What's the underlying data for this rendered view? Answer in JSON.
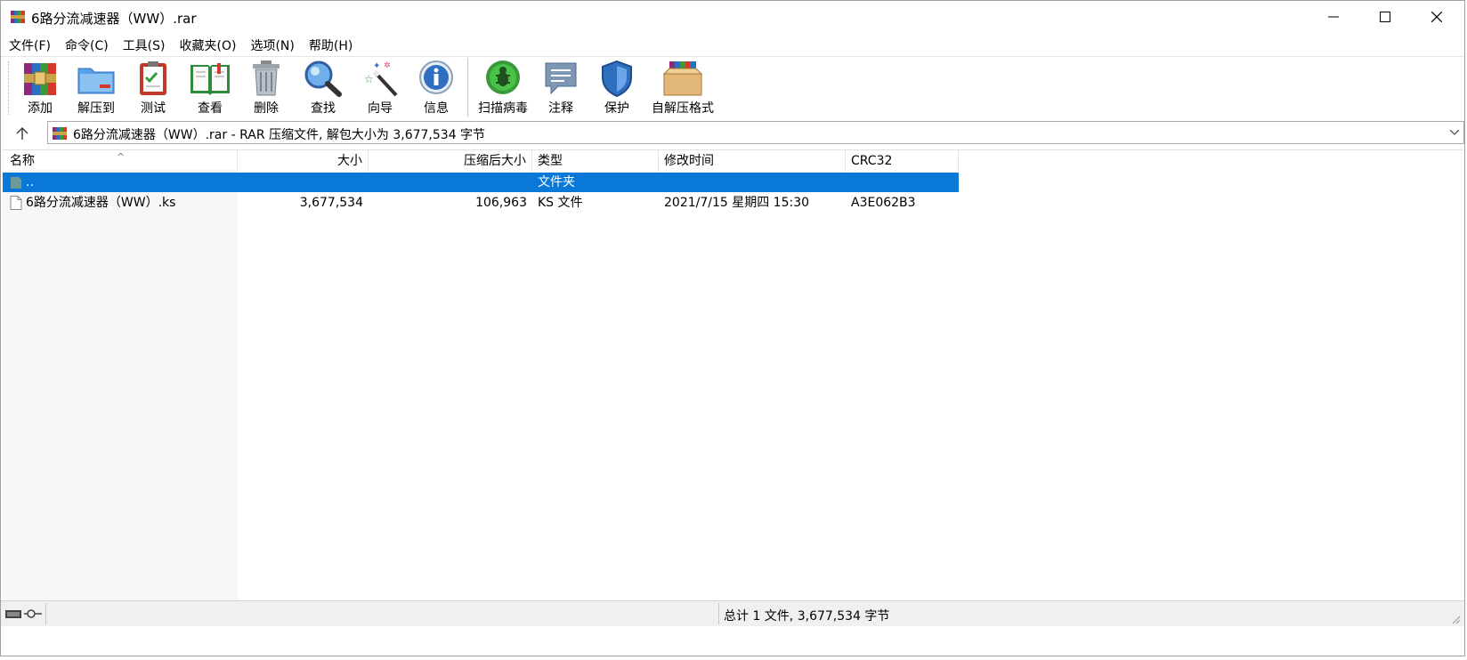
{
  "window": {
    "title": "6路分流减速器（WW）.rar"
  },
  "menu": [
    {
      "label": "文件(F)"
    },
    {
      "label": "命令(C)"
    },
    {
      "label": "工具(S)"
    },
    {
      "label": "收藏夹(O)"
    },
    {
      "label": "选项(N)"
    },
    {
      "label": "帮助(H)"
    }
  ],
  "toolbar": {
    "add": "添加",
    "extract": "解压到",
    "test": "测试",
    "view": "查看",
    "delete": "删除",
    "find": "查找",
    "wizard": "向导",
    "info": "信息",
    "scan": "扫描病毒",
    "comment": "注释",
    "protect": "保护",
    "sfx": "自解压格式"
  },
  "address": {
    "text": "6路分流减速器（WW）.rar - RAR 压缩文件, 解包大小为 3,677,534 字节"
  },
  "columns": {
    "name": "名称",
    "size": "大小",
    "packed": "压缩后大小",
    "type": "类型",
    "modified": "修改时间",
    "crc": "CRC32"
  },
  "rows": [
    {
      "name": "..",
      "size": "",
      "packed": "",
      "type": "文件夹",
      "modified": "",
      "crc": ""
    },
    {
      "name": "6路分流减速器（WW）.ks",
      "size": "3,677,534",
      "packed": "106,963",
      "type": "KS 文件",
      "modified": "2021/7/15 星期四 15:30",
      "crc": "A3E062B3"
    }
  ],
  "status": {
    "text": "总计 1 文件, 3,677,534 字节"
  },
  "colors": {
    "selection": "#0a78d7",
    "accent_blue": "#2f6fbf"
  }
}
